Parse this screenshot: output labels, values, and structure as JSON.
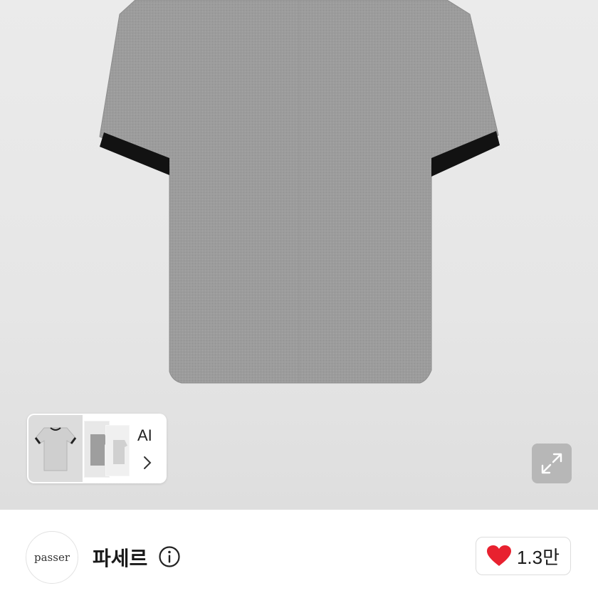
{
  "gallery": {
    "ai_card": {
      "label": "AI",
      "chevron": "chevron-right-icon"
    },
    "expand_icon": "expand-icon",
    "background": "#e6e6e6",
    "product_colors": {
      "body": "#9a9a9a",
      "trim": "#111111"
    }
  },
  "seller": {
    "avatar_text": "passer",
    "name": "파세르",
    "info_icon": "info-icon"
  },
  "like": {
    "icon": "heart-icon",
    "count": "1.3만",
    "heart_color": "#e8212f"
  }
}
